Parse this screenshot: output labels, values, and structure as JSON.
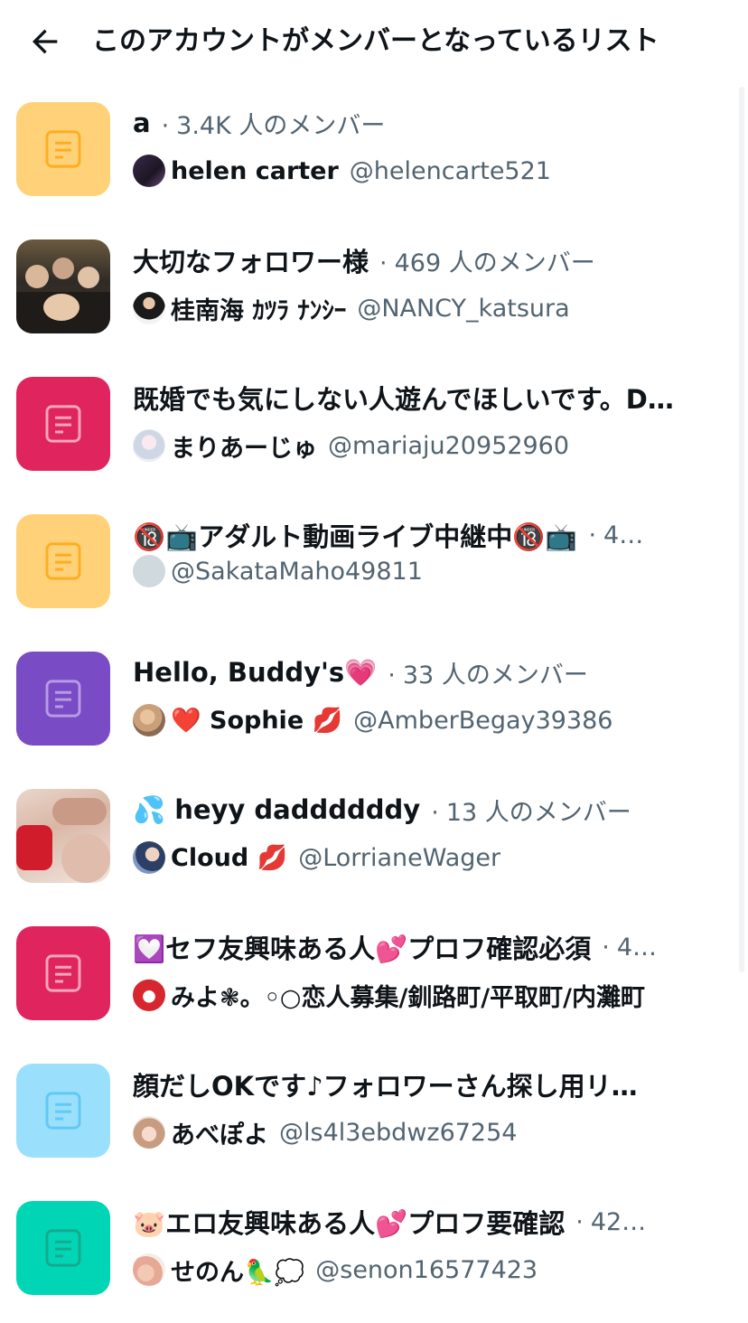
{
  "header": {
    "title": "このアカウントがメンバーとなっているリスト"
  },
  "colors": {
    "yellow": "#ffd27a",
    "yellow_icon": "#ffad1f",
    "pink": "#e0245e",
    "purple": "#794bc4",
    "sky": "#9ae0fc",
    "sky_icon": "#62c8f5",
    "teal": "#00d6b5"
  },
  "lists": [
    {
      "name": "a",
      "members": "3.4K 人のメンバー",
      "owner_name": "helen carter",
      "owner_handle": "@helencarte521",
      "thumb": "yellow"
    },
    {
      "name": "大切なフォロワー様",
      "members": "469 人のメンバー",
      "owner_name": "桂南海 ｶﾂﾗ ﾅﾝｼｰ",
      "owner_handle": "@NANCY_katsura",
      "thumb": "photo"
    },
    {
      "name": "既婚でも気にしない人遊んでほしいです。D…",
      "members": "",
      "owner_name": "まりあーじゅ",
      "owner_handle": "@mariaju20952960",
      "thumb": "pink"
    },
    {
      "name": "🔞📺アダルト動画ライブ中継中🔞📺",
      "members": "4…",
      "owner_name": "",
      "owner_handle": "@SakataMaho49811",
      "thumb": "yellow"
    },
    {
      "name": "Hello, Buddy's💗",
      "members": "33 人のメンバー",
      "owner_name": "❤️ Sophie 💋",
      "owner_handle": "@AmberBegay39386",
      "thumb": "purple"
    },
    {
      "name": "💦 heyy daddddddy",
      "members": "13 人のメンバー",
      "owner_name": "Cloud 💋",
      "owner_handle": "@LorrianeWager",
      "thumb": "photo2"
    },
    {
      "name": "💟セフ友興味ある人💕プロフ確認必須",
      "members": "4…",
      "owner_name": "みよ❃。◦○恋人募集/釧路町/平取町/内灘町",
      "owner_handle": "",
      "thumb": "pink"
    },
    {
      "name": "顔だしOKです♪フォロワーさん探し用リ…",
      "members": "",
      "owner_name": "あべぽよ",
      "owner_handle": "@ls4l3ebdwz67254",
      "thumb": "sky"
    },
    {
      "name": "🐷エロ友興味ある人💕プロフ要確認",
      "members": "42…",
      "owner_name": "せのん🦜💭",
      "owner_handle": "@senon16577423",
      "thumb": "teal"
    }
  ]
}
